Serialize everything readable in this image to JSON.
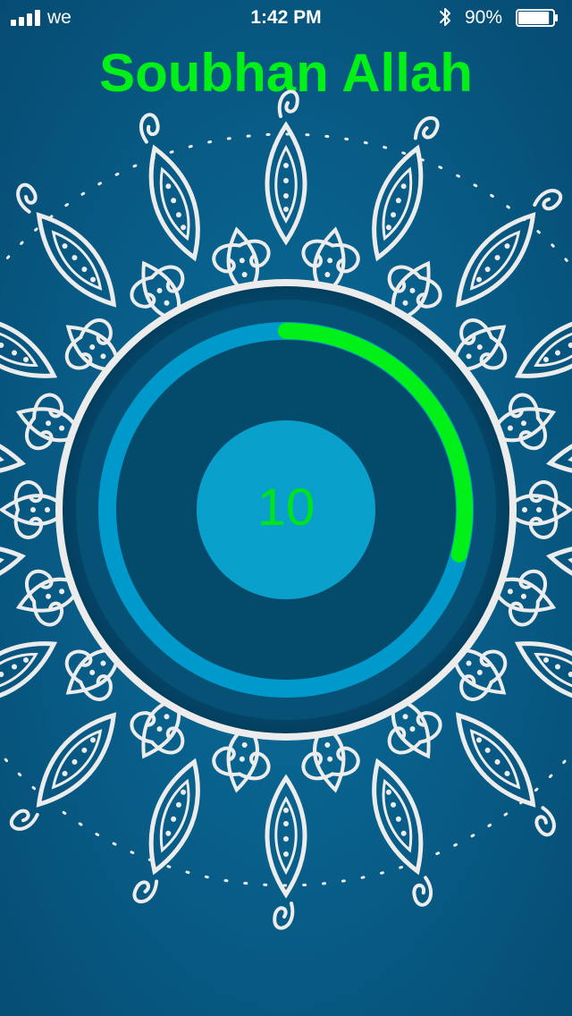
{
  "status_bar": {
    "carrier": "we",
    "time": "1:42 PM",
    "battery_percent": "90%",
    "battery_level": 0.9,
    "signal_bars": 4,
    "bluetooth": "bluetooth-icon"
  },
  "title": "Soubhan Allah",
  "counter": {
    "value": "10",
    "progress_fraction": 0.29
  },
  "colors": {
    "title": "#00f018",
    "counter_text": "#00e51a",
    "progress_arc": "#00f018",
    "outer_ring": "#0099cc",
    "dial": "#044b6b",
    "inner_button": "#0aa0cc",
    "mandala": "#ececec",
    "background": "#085f8a"
  }
}
